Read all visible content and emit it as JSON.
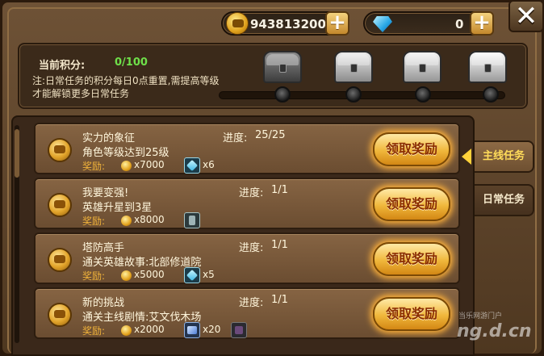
{
  "currency": {
    "gold": "943813200",
    "gems": "0",
    "plus_label": "+"
  },
  "close_label": "✕",
  "score": {
    "label": "当前积分:",
    "value": "0/100",
    "note": "注:日常任务的积分每日0点重置,需提高等级才能解锁更多日常任务"
  },
  "chests": [
    "iron-chest-icon",
    "silver-chest-icon",
    "ornate-chest-icon",
    "royal-chest-icon"
  ],
  "tasks": [
    {
      "title": "实力的象征",
      "desc": "角色等级达到25级",
      "progress_label": "进度:",
      "progress": "25/25",
      "reward_label": "奖励:",
      "gold": "x7000",
      "items": [
        {
          "icon": "blade-icon",
          "count": "x6"
        }
      ],
      "claim": "领取奖励"
    },
    {
      "title": "我要变强!",
      "desc": "英雄升星到3星",
      "progress_label": "进度:",
      "progress": "1/1",
      "reward_label": "奖励:",
      "gold": "x8000",
      "items": [
        {
          "icon": "armor-icon",
          "count": ""
        }
      ],
      "claim": "领取奖励"
    },
    {
      "title": "塔防高手",
      "desc": "通关英雄故事:北部修道院",
      "progress_label": "进度:",
      "progress": "1/1",
      "reward_label": "奖励:",
      "gold": "x5000",
      "items": [
        {
          "icon": "blade-icon",
          "count": "x5"
        }
      ],
      "claim": "领取奖励"
    },
    {
      "title": "新的挑战",
      "desc": "通关主线剧情:艾文伐木场",
      "progress_label": "进度:",
      "progress": "1/1",
      "reward_label": "奖励:",
      "gold": "x2000",
      "items": [
        {
          "icon": "gem-icon",
          "count": "x20"
        },
        {
          "icon": "dark-item-icon",
          "count": ""
        }
      ],
      "claim": "领取奖励"
    }
  ],
  "tabs": {
    "main": "主线任务",
    "daily": "日常任务"
  },
  "watermark": {
    "top": "当乐网游门户",
    "main": "ng.d.cn"
  },
  "colors": {
    "score_value": "#6fe04a",
    "reward_label": "#f0b23a",
    "active_tab_text": "#ffdc5a"
  }
}
